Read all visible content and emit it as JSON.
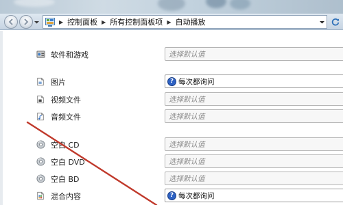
{
  "address_bar": {
    "crumbs": [
      "控制面板",
      "所有控制面板项",
      "自动播放"
    ]
  },
  "icons": {
    "back": "back-arrow-icon",
    "forward": "forward-arrow-icon",
    "refresh": "refresh-icon",
    "control_panel": "control-panel-icon"
  },
  "rows": [
    {
      "label": "软件和游戏",
      "icon": "software-games-icon",
      "value": "选择默认值",
      "placeholder": true
    },
    {
      "label": "图片",
      "icon": "picture-file-icon",
      "value": "每次都询问",
      "placeholder": false
    },
    {
      "label": "视频文件",
      "icon": "video-file-icon",
      "value": "选择默认值",
      "placeholder": true
    },
    {
      "label": "音频文件",
      "icon": "audio-file-icon",
      "value": "选择默认值",
      "placeholder": true
    },
    {
      "label": "空白 CD",
      "icon": "disc-icon",
      "value": "选择默认值",
      "placeholder": true
    },
    {
      "label": "空白 DVD",
      "icon": "disc-icon",
      "value": "选择默认值",
      "placeholder": true
    },
    {
      "label": "空白 BD",
      "icon": "disc-icon",
      "value": "选择默认值",
      "placeholder": true
    },
    {
      "label": "混合内容",
      "icon": "mixed-content-icon",
      "value": "每次都询问",
      "placeholder": false
    }
  ],
  "colors": {
    "annotation_line": "#c0392b",
    "question_badge": "#2e62c4"
  }
}
